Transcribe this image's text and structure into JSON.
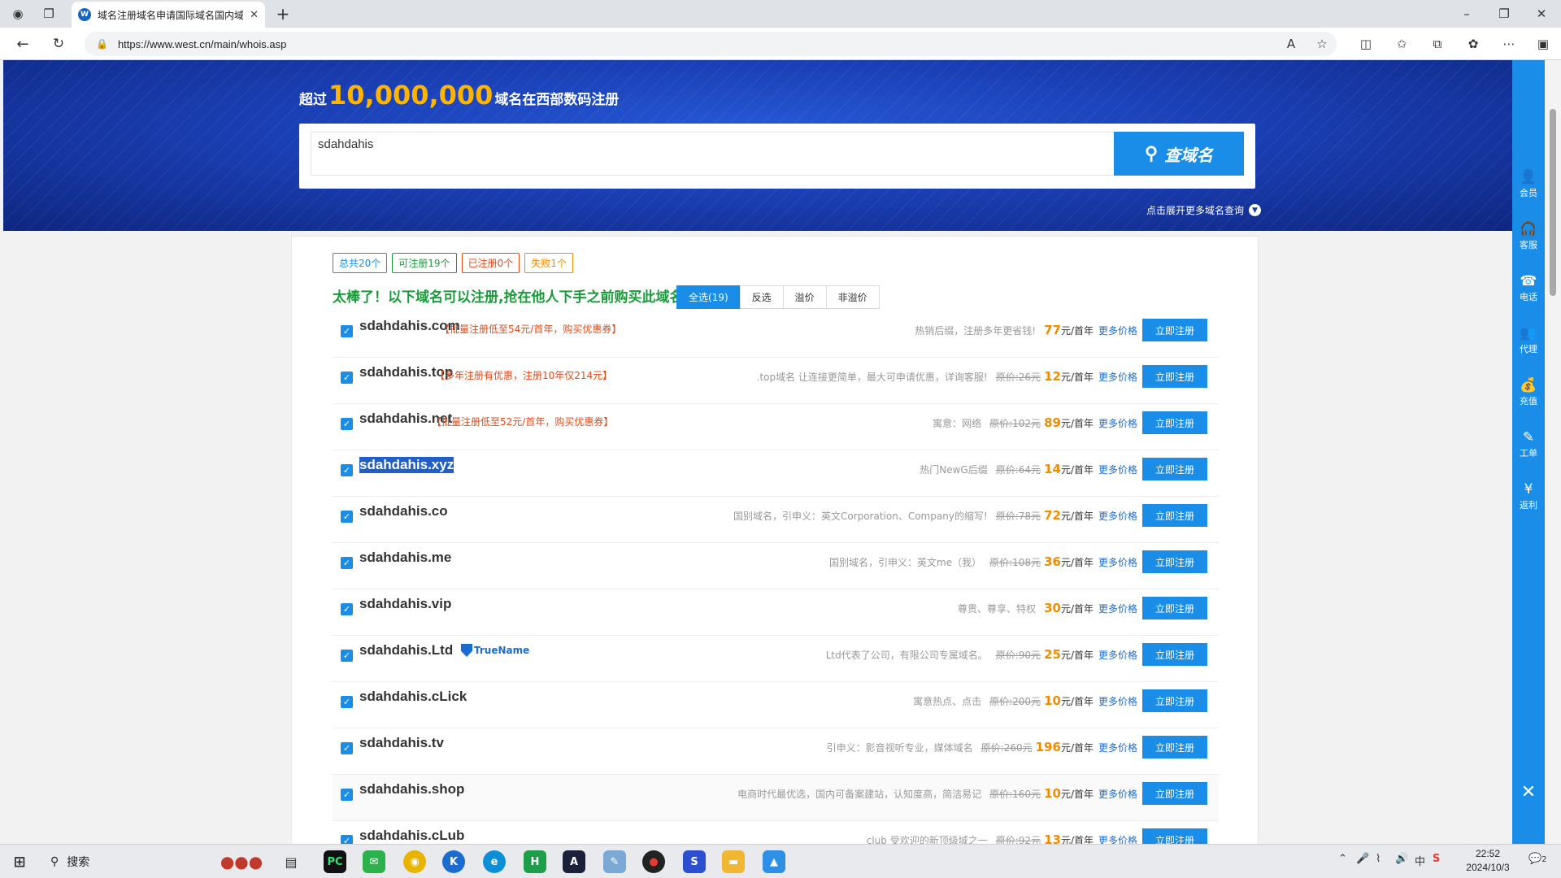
{
  "browser": {
    "tab_title": "域名注册域名申请国际域名国内域",
    "url": "https://www.west.cn/main/whois.asp"
  },
  "banner": {
    "headline_pre": "超过",
    "headline_number": "10,000,000",
    "headline_post": "域名在西部数码注册",
    "search_value": "sdahdahis",
    "search_button": "查域名",
    "expand_link": "点击展开更多域名查询"
  },
  "stats": [
    {
      "label": "总共20个",
      "color": "#1a8de9"
    },
    {
      "label": "可注册19个",
      "color": "#1a9b3a"
    },
    {
      "label": "已注册0个",
      "color": "#e04b1a"
    },
    {
      "label": "失败1个",
      "color": "#f08c00"
    }
  ],
  "promo_title": "太棒了！以下域名可以注册,抢在他人下手之前购买此域名!",
  "filters": [
    "全选(19)",
    "反选",
    "溢价",
    "非溢价"
  ],
  "domains": [
    {
      "name": "sdahdahis.com",
      "promo": "【批量注册低至54元/首年，购买优惠券】",
      "desc": "热销后缀，注册多年更省钱!",
      "orig": "",
      "price": "77",
      "unit": "元/首年"
    },
    {
      "name": "sdahdahis.top",
      "promo": "【多年注册有优惠，注册10年仅214元】",
      "desc": ".top域名 让连接更简单，最大可申请优惠，详询客服!",
      "orig": "原价:26元",
      "price": "12",
      "unit": "元/首年"
    },
    {
      "name": "sdahdahis.net",
      "promo": "【批量注册低至52元/首年，购买优惠券】",
      "desc": "寓意：网络",
      "orig": "原价:102元",
      "price": "89",
      "unit": "元/首年"
    },
    {
      "name": "sdahdahis.xyz",
      "promo": "",
      "desc": "热门NewG后缀",
      "orig": "原价:64元",
      "price": "14",
      "unit": "元/首年"
    },
    {
      "name": "sdahdahis.co",
      "promo": "",
      "desc": "国别域名，引申义：英文Corporation、Company的缩写!",
      "orig": "原价:78元",
      "price": "72",
      "unit": "元/首年"
    },
    {
      "name": "sdahdahis.me",
      "promo": "",
      "desc": "国别域名，引申义：英文me（我）",
      "orig": "原价:108元",
      "price": "36",
      "unit": "元/首年"
    },
    {
      "name": "sdahdahis.vip",
      "promo": "",
      "desc": "尊贵、尊享、特权",
      "orig": "",
      "price": "30",
      "unit": "元/首年"
    },
    {
      "name": "sdahdahis.Ltd",
      "promo": "",
      "logo": "TrueName",
      "desc": "Ltd代表了公司，有限公司专属域名。",
      "orig": "原价:90元",
      "price": "25",
      "unit": "元/首年"
    },
    {
      "name": "sdahdahis.cLick",
      "promo": "",
      "desc": "寓意热点、点击",
      "orig": "原价:200元",
      "price": "10",
      "unit": "元/首年"
    },
    {
      "name": "sdahdahis.tv",
      "promo": "",
      "desc": "引申义：影音视听专业，媒体域名",
      "orig": "原价:260元",
      "price": "196",
      "unit": "元/首年"
    },
    {
      "name": "sdahdahis.shop",
      "promo": "",
      "desc": "电商时代最优选，国内可备案建站，认知度高，简洁易记",
      "orig": "原价:160元",
      "price": "10",
      "unit": "元/首年"
    },
    {
      "name": "sdahdahis.cLub",
      "promo": "",
      "desc": "club 受欢迎的新顶级域之一",
      "orig": "原价:92元",
      "price": "13",
      "unit": "元/首年"
    }
  ],
  "row_actions": {
    "more": "更多价格",
    "register": "立即注册"
  },
  "sidebar": [
    {
      "label": "会员",
      "icon": "user-icon",
      "glyph": "👤"
    },
    {
      "label": "客服",
      "icon": "headset-icon",
      "glyph": "🎧"
    },
    {
      "label": "电话",
      "icon": "phone-icon",
      "glyph": "☎"
    },
    {
      "label": "代理",
      "icon": "agent-icon",
      "glyph": "👥"
    },
    {
      "label": "充值",
      "icon": "money-bag-icon",
      "glyph": "💰"
    },
    {
      "label": "工单",
      "icon": "ticket-icon",
      "glyph": "✎"
    },
    {
      "label": "返利",
      "icon": "rebate-icon",
      "glyph": "¥"
    }
  ],
  "taskbar": {
    "search_label": "搜索",
    "time": "22:52",
    "date": "2024/10/3",
    "ime": "中",
    "notification_count": "2"
  }
}
